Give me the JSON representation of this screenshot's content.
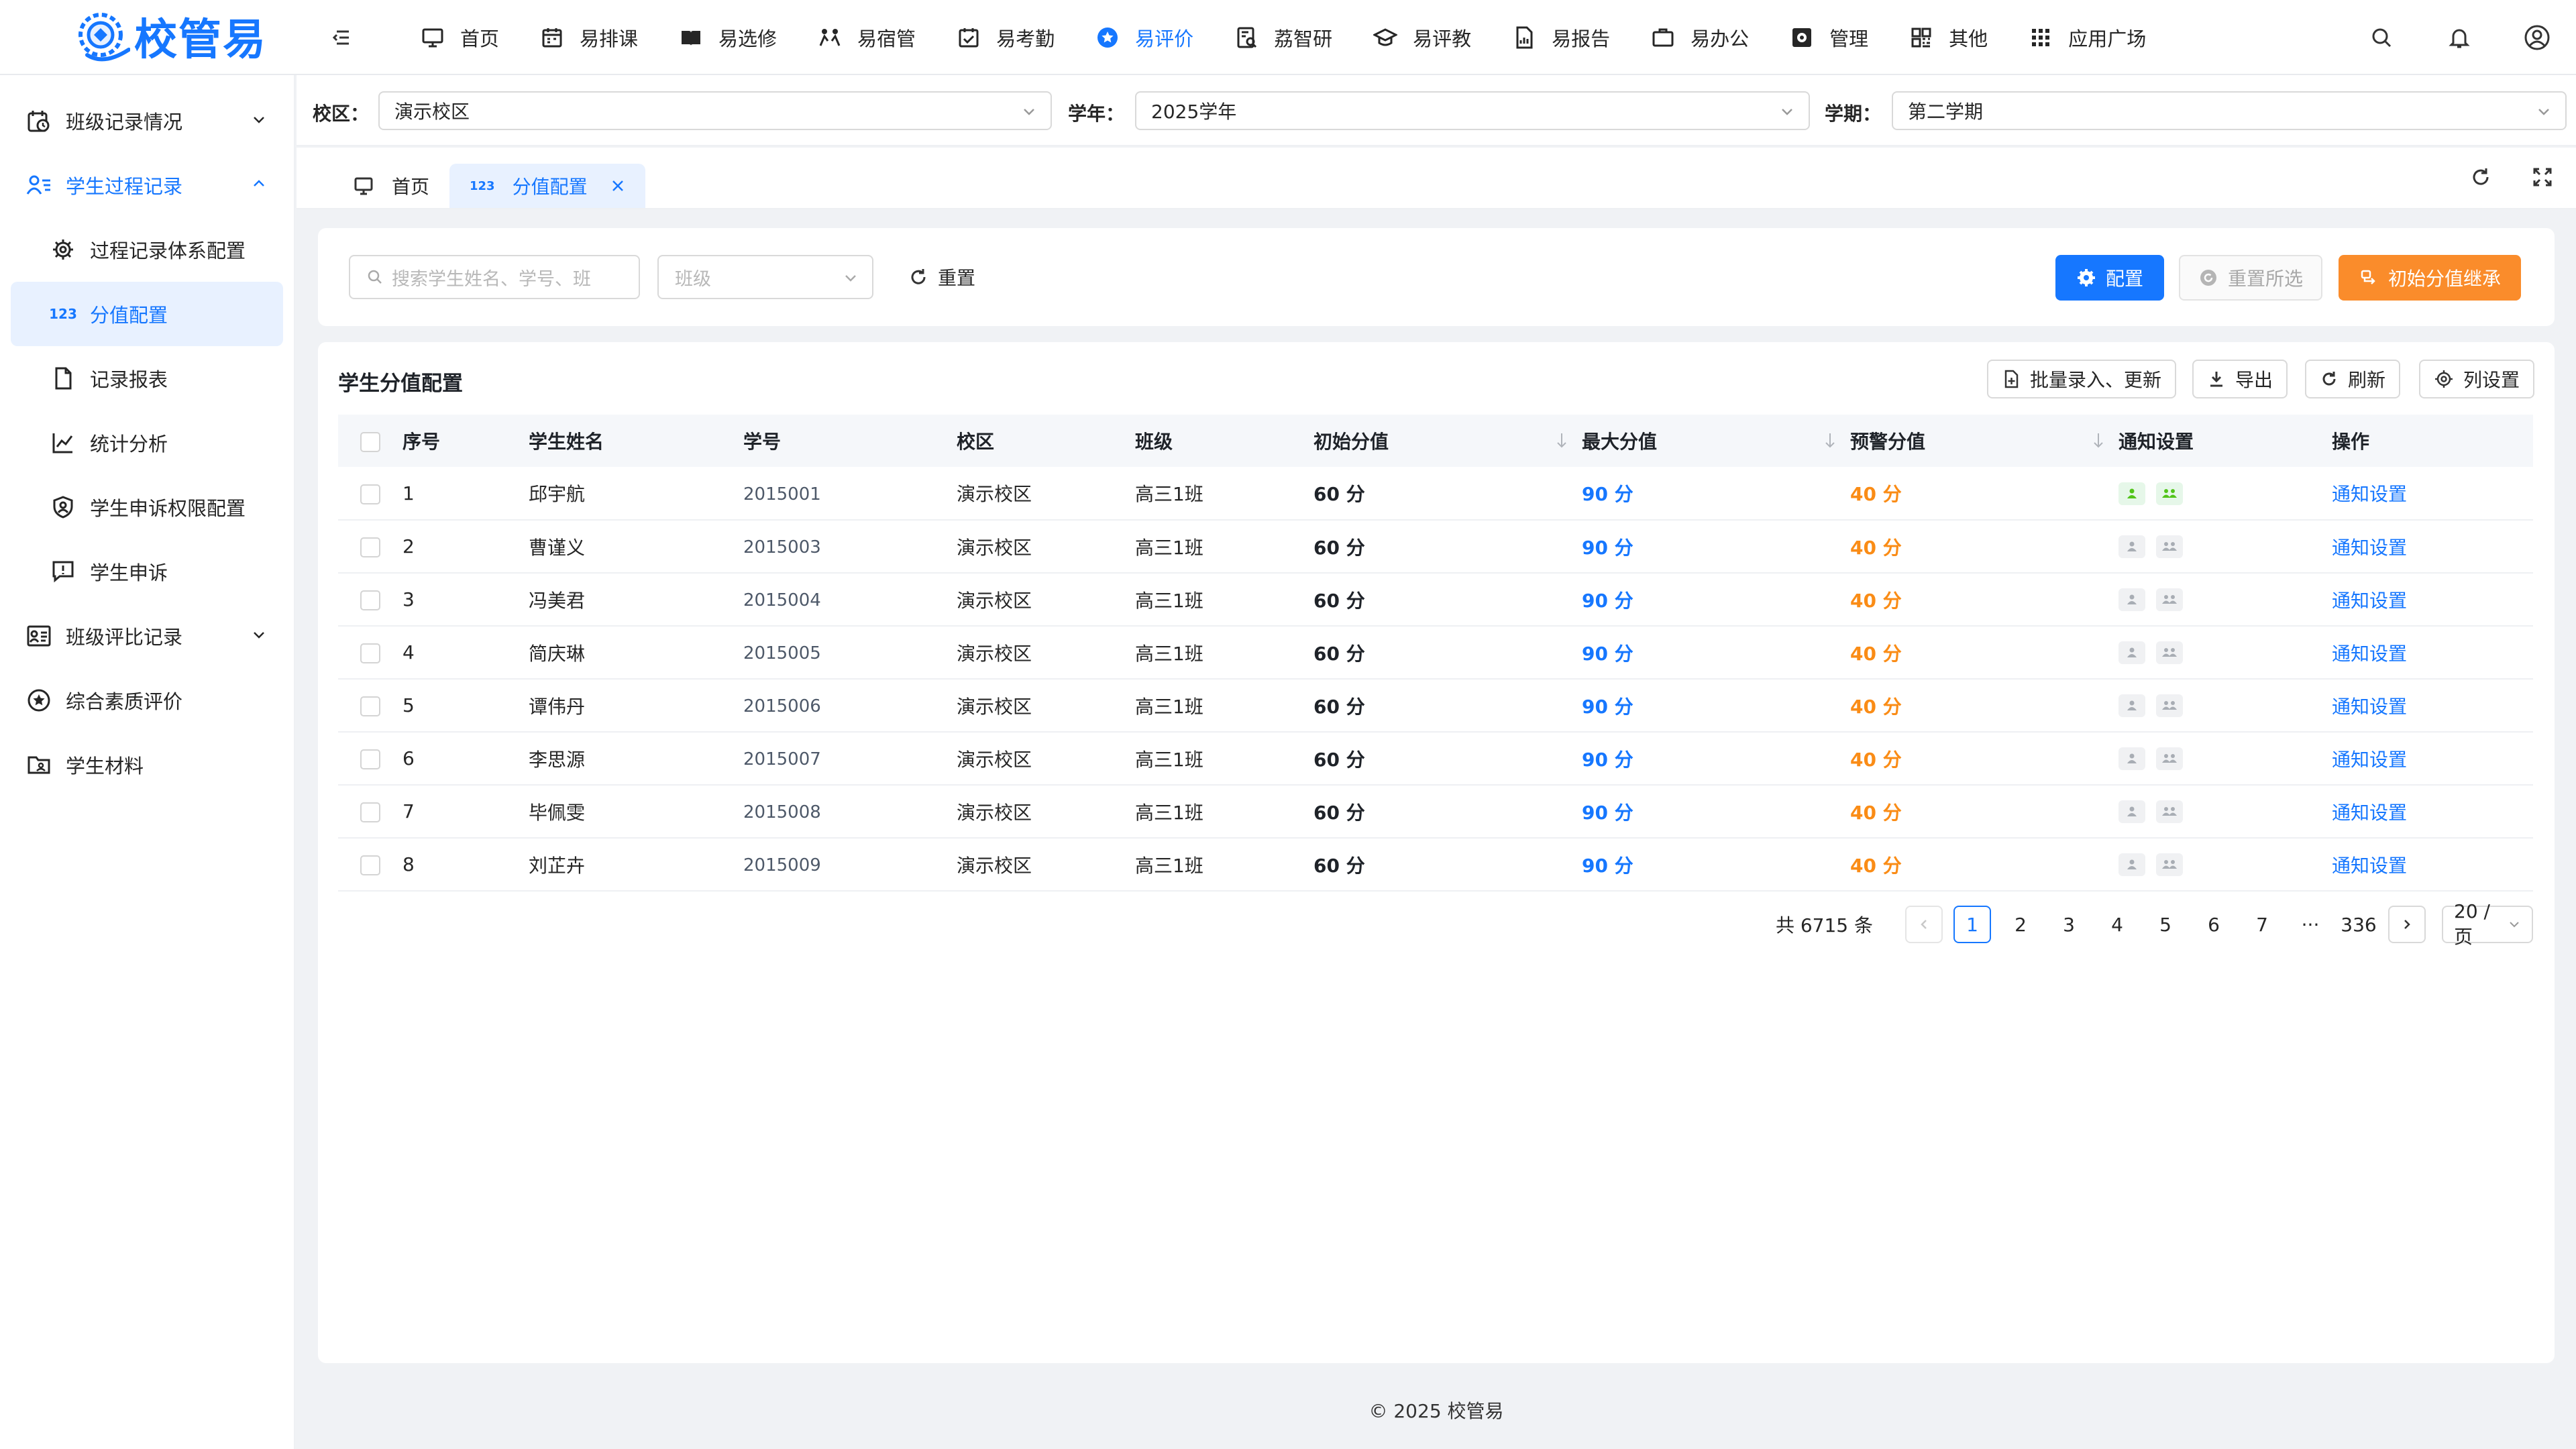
{
  "app": {
    "logo_text": "校管易",
    "footer": "© 2025 校管易"
  },
  "nav": {
    "items": [
      {
        "label": "首页",
        "icon": "monitor-icon"
      },
      {
        "label": "易排课",
        "icon": "calendar-icon"
      },
      {
        "label": "易选修",
        "icon": "book-icon"
      },
      {
        "label": "易宿管",
        "icon": "dorm-icon"
      },
      {
        "label": "易考勤",
        "icon": "checkin-icon"
      },
      {
        "label": "易评价",
        "icon": "star-icon"
      },
      {
        "label": "荔智研",
        "icon": "research-icon"
      },
      {
        "label": "易评教",
        "icon": "graduation-icon"
      },
      {
        "label": "易报告",
        "icon": "report-icon"
      },
      {
        "label": "易办公",
        "icon": "briefcase-icon"
      },
      {
        "label": "管理",
        "icon": "settings-box-icon"
      },
      {
        "label": "其他",
        "icon": "grid-icon"
      },
      {
        "label": "应用广场",
        "icon": "apps-icon"
      }
    ],
    "active_index": 5
  },
  "sidebar": {
    "items": [
      {
        "label": "班级记录情况",
        "icon": "class-record-icon",
        "level": 0,
        "expandable": true,
        "expanded": false
      },
      {
        "label": "学生过程记录",
        "icon": "student-list-icon",
        "level": 0,
        "expandable": true,
        "expanded": true
      },
      {
        "label": "过程记录体系配置",
        "icon": "gear-icon",
        "level": 1
      },
      {
        "label": "分值配置",
        "icon": "123",
        "level": 1,
        "selected": true
      },
      {
        "label": "记录报表",
        "icon": "document-icon",
        "level": 1
      },
      {
        "label": "统计分析",
        "icon": "line-chart-icon",
        "level": 1
      },
      {
        "label": "学生申诉权限配置",
        "icon": "shield-user-icon",
        "level": 1
      },
      {
        "label": "学生申诉",
        "icon": "message-alert-icon",
        "level": 1
      },
      {
        "label": "班级评比记录",
        "icon": "class-compare-icon",
        "level": 0,
        "expandable": true,
        "expanded": false
      },
      {
        "label": "综合素质评价",
        "icon": "star-circle-icon",
        "level": 0
      },
      {
        "label": "学生材料",
        "icon": "folder-user-icon",
        "level": 0
      }
    ]
  },
  "filters": {
    "campus_label": "校区：",
    "campus_value": "演示校区",
    "year_label": "学年：",
    "year_value": "2025学年",
    "term_label": "学期：",
    "term_value": "第二学期"
  },
  "tabs": {
    "home": "首页",
    "current_icon": "123",
    "current": "分值配置"
  },
  "search": {
    "placeholder": "搜索学生姓名、学号、班",
    "class_placeholder": "班级",
    "reset": "重置",
    "config_btn": "配置",
    "reset_selected_btn": "重置所选",
    "inherit_btn": "初始分值继承"
  },
  "table": {
    "title": "学生分值配置",
    "tools": {
      "batch": "批量录入、更新",
      "export": "导出",
      "refresh": "刷新",
      "columns": "列设置"
    },
    "headers": [
      "序号",
      "学生姓名",
      "学号",
      "校区",
      "班级",
      "初始分值",
      "最大分值",
      "预警分值",
      "通知设置",
      "操作"
    ],
    "rows": [
      {
        "idx": "1",
        "name": "邱宇航",
        "id": "2015001",
        "campus": "演示校区",
        "class": "高三1班",
        "init": "60 分",
        "max": "90 分",
        "warn": "40 分",
        "notify_on": true,
        "action": "通知设置"
      },
      {
        "idx": "2",
        "name": "曹谨义",
        "id": "2015003",
        "campus": "演示校区",
        "class": "高三1班",
        "init": "60 分",
        "max": "90 分",
        "warn": "40 分",
        "notify_on": false,
        "action": "通知设置"
      },
      {
        "idx": "3",
        "name": "冯美君",
        "id": "2015004",
        "campus": "演示校区",
        "class": "高三1班",
        "init": "60 分",
        "max": "90 分",
        "warn": "40 分",
        "notify_on": false,
        "action": "通知设置"
      },
      {
        "idx": "4",
        "name": "简庆琳",
        "id": "2015005",
        "campus": "演示校区",
        "class": "高三1班",
        "init": "60 分",
        "max": "90 分",
        "warn": "40 分",
        "notify_on": false,
        "action": "通知设置"
      },
      {
        "idx": "5",
        "name": "谭伟丹",
        "id": "2015006",
        "campus": "演示校区",
        "class": "高三1班",
        "init": "60 分",
        "max": "90 分",
        "warn": "40 分",
        "notify_on": false,
        "action": "通知设置"
      },
      {
        "idx": "6",
        "name": "李思源",
        "id": "2015007",
        "campus": "演示校区",
        "class": "高三1班",
        "init": "60 分",
        "max": "90 分",
        "warn": "40 分",
        "notify_on": false,
        "action": "通知设置"
      },
      {
        "idx": "7",
        "name": "毕佩雯",
        "id": "2015008",
        "campus": "演示校区",
        "class": "高三1班",
        "init": "60 分",
        "max": "90 分",
        "warn": "40 分",
        "notify_on": false,
        "action": "通知设置"
      },
      {
        "idx": "8",
        "name": "刘芷卉",
        "id": "2015009",
        "campus": "演示校区",
        "class": "高三1班",
        "init": "60 分",
        "max": "90 分",
        "warn": "40 分",
        "notify_on": false,
        "action": "通知设置"
      }
    ]
  },
  "pagination": {
    "total": "共 6715 条",
    "pages": [
      "1",
      "2",
      "3",
      "4",
      "5",
      "6",
      "7",
      "···",
      "336"
    ],
    "current": "1",
    "page_size": "20 / 页"
  },
  "colors": {
    "primary": "#1677ff",
    "warning": "#fa8c2b",
    "success": "#52c41a"
  }
}
